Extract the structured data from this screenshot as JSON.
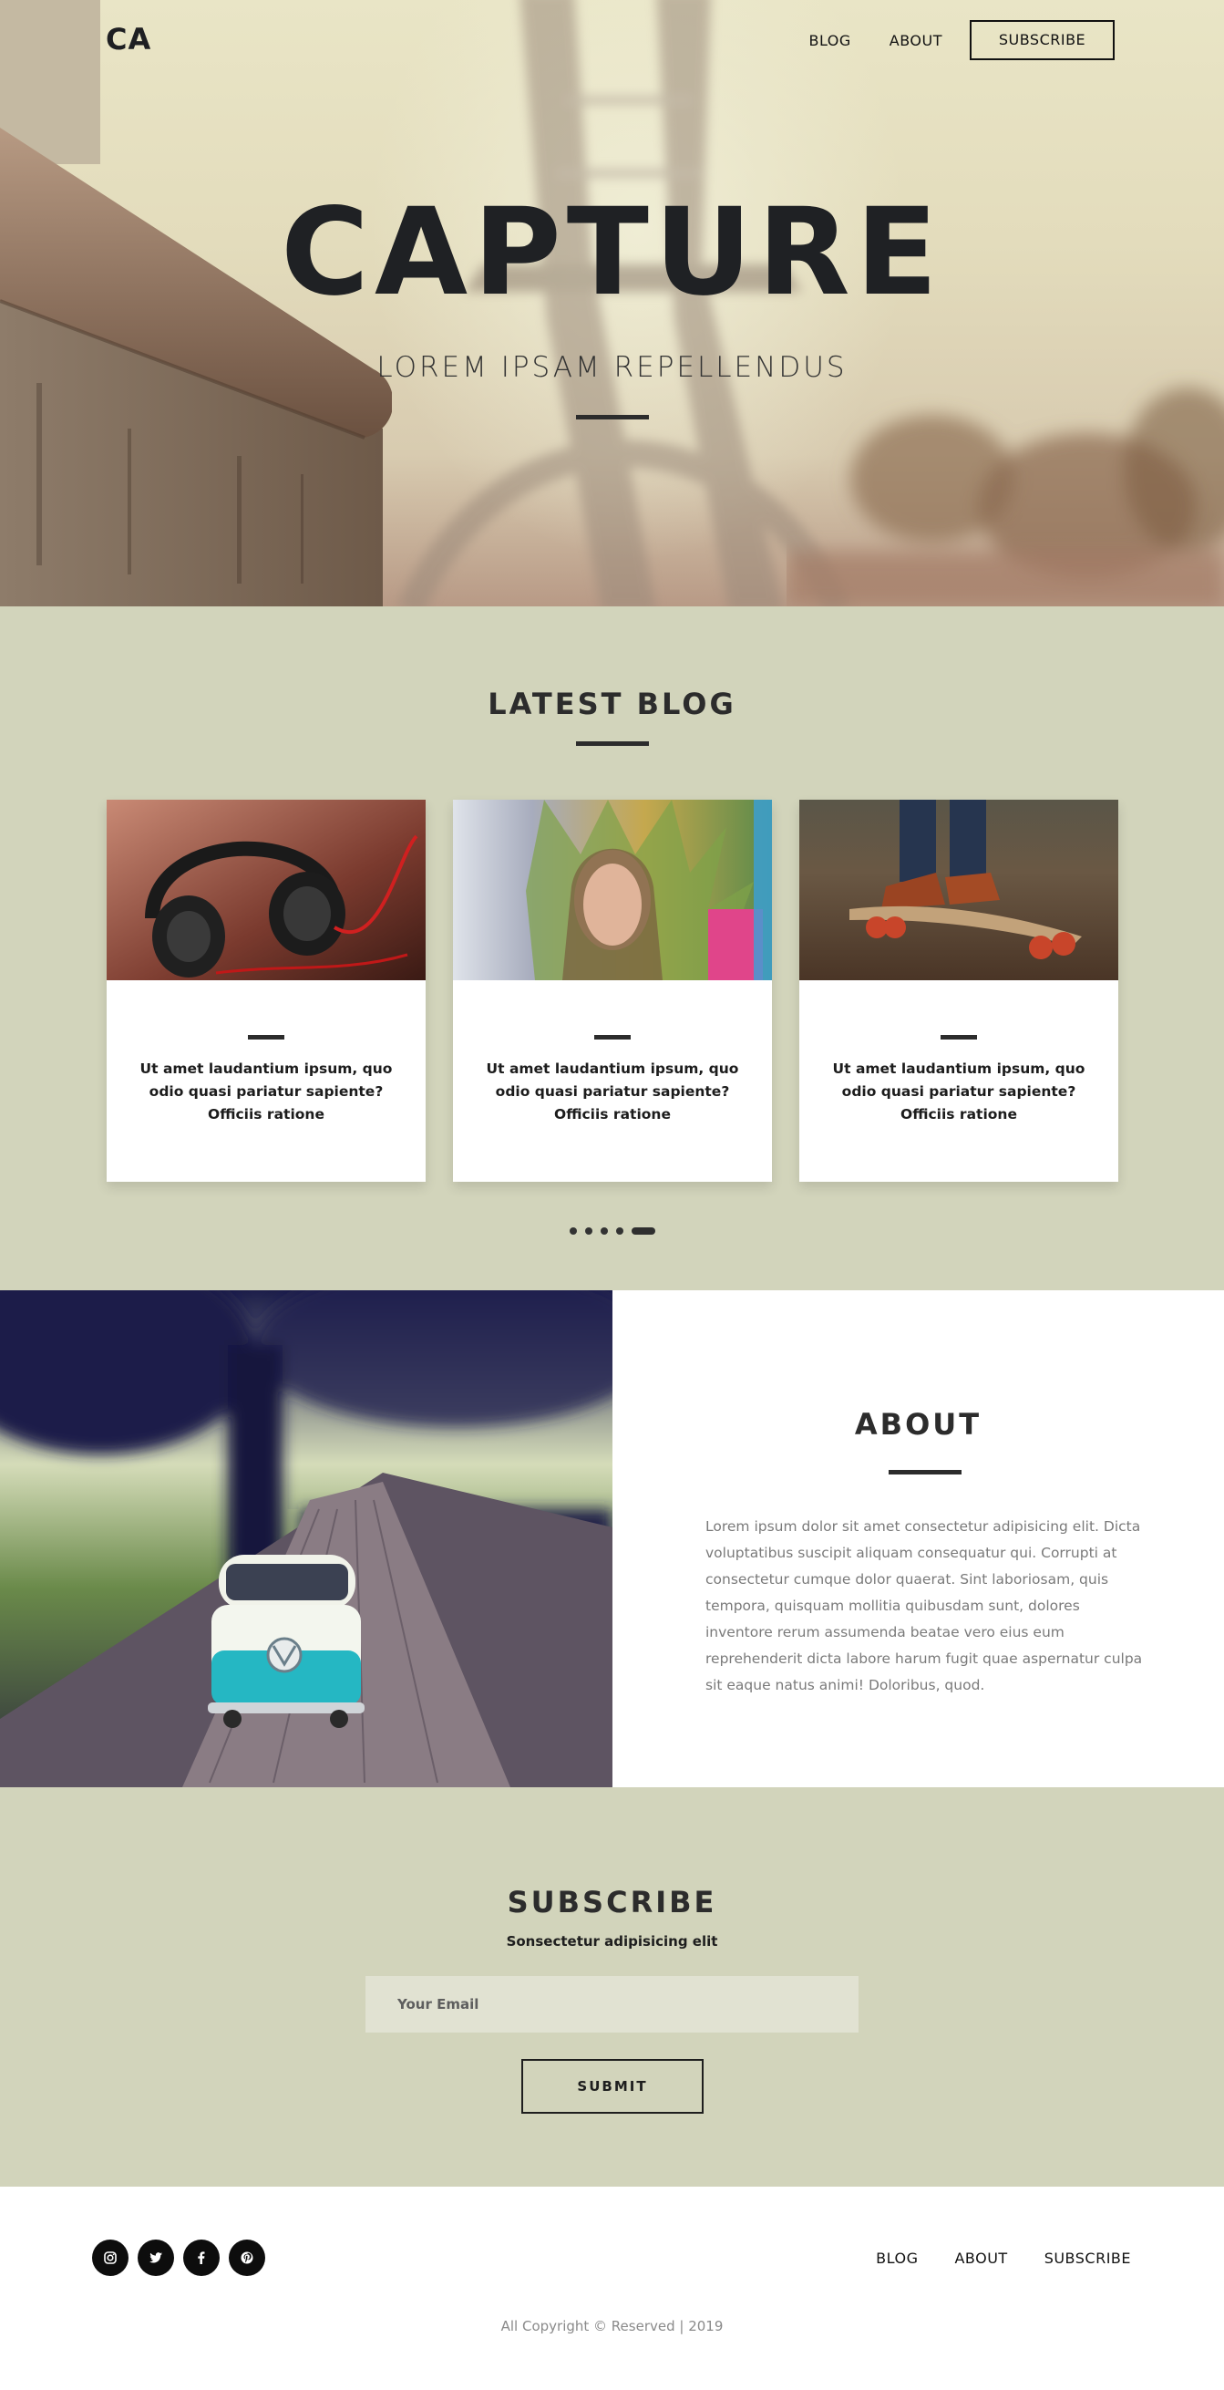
{
  "header": {
    "logo": "CA",
    "nav": {
      "blog": "BLOG",
      "about": "ABOUT",
      "subscribe": "SUBSCRIBE"
    }
  },
  "hero": {
    "title": "CAPTURE",
    "subtitle": "LOREM IPSAM REPELLENDUS"
  },
  "blog": {
    "title": "LATEST BLOG",
    "posts": [
      {
        "image": "headphones-photo",
        "text": "Ut amet laudantium ipsum, quo odio quasi pariatur sapiente? Officiis ratione"
      },
      {
        "image": "feather-headdress-portrait-photo",
        "text": "Ut amet laudantium ipsum, quo odio quasi pariatur sapiente? Officiis ratione"
      },
      {
        "image": "longboard-photo",
        "text": "Ut amet laudantium ipsum, quo odio quasi pariatur sapiente? Officiis ratione"
      }
    ],
    "pagination": {
      "total_dots": 5,
      "active_index": 4
    }
  },
  "about": {
    "title": "ABOUT",
    "image": "toy-van-photo",
    "body": "Lorem ipsum dolor sit amet consectetur adipisicing elit. Dicta voluptatibus suscipit aliquam consequatur qui. Corrupti at consectetur cumque dolor quaerat. Sint laboriosam, quis tempora, quisquam mollitia quibusdam sunt, dolores inventore rerum assumenda beatae vero eius eum reprehenderit dicta labore harum fugit quae aspernatur culpa sit eaque natus animi! Doloribus, quod."
  },
  "subscribe": {
    "title": "SUBSCRIBE",
    "tagline": "Sonsectetur adipisicing elit",
    "email_placeholder": "Your Email",
    "submit_label": "SUBMIT"
  },
  "footer": {
    "socials": [
      "instagram-icon",
      "twitter-icon",
      "facebook-icon",
      "pinterest-icon"
    ],
    "nav": {
      "blog": "BLOG",
      "about": "ABOUT",
      "subscribe": "SUBSCRIBE"
    },
    "copyright": "All Copyright © Reserved | 2019"
  },
  "colors": {
    "section_bg": "#d2d4bb",
    "text_dark": "#2c2c2c",
    "input_bg": "#e1e2d2",
    "social_bg": "#0d0d0d"
  }
}
